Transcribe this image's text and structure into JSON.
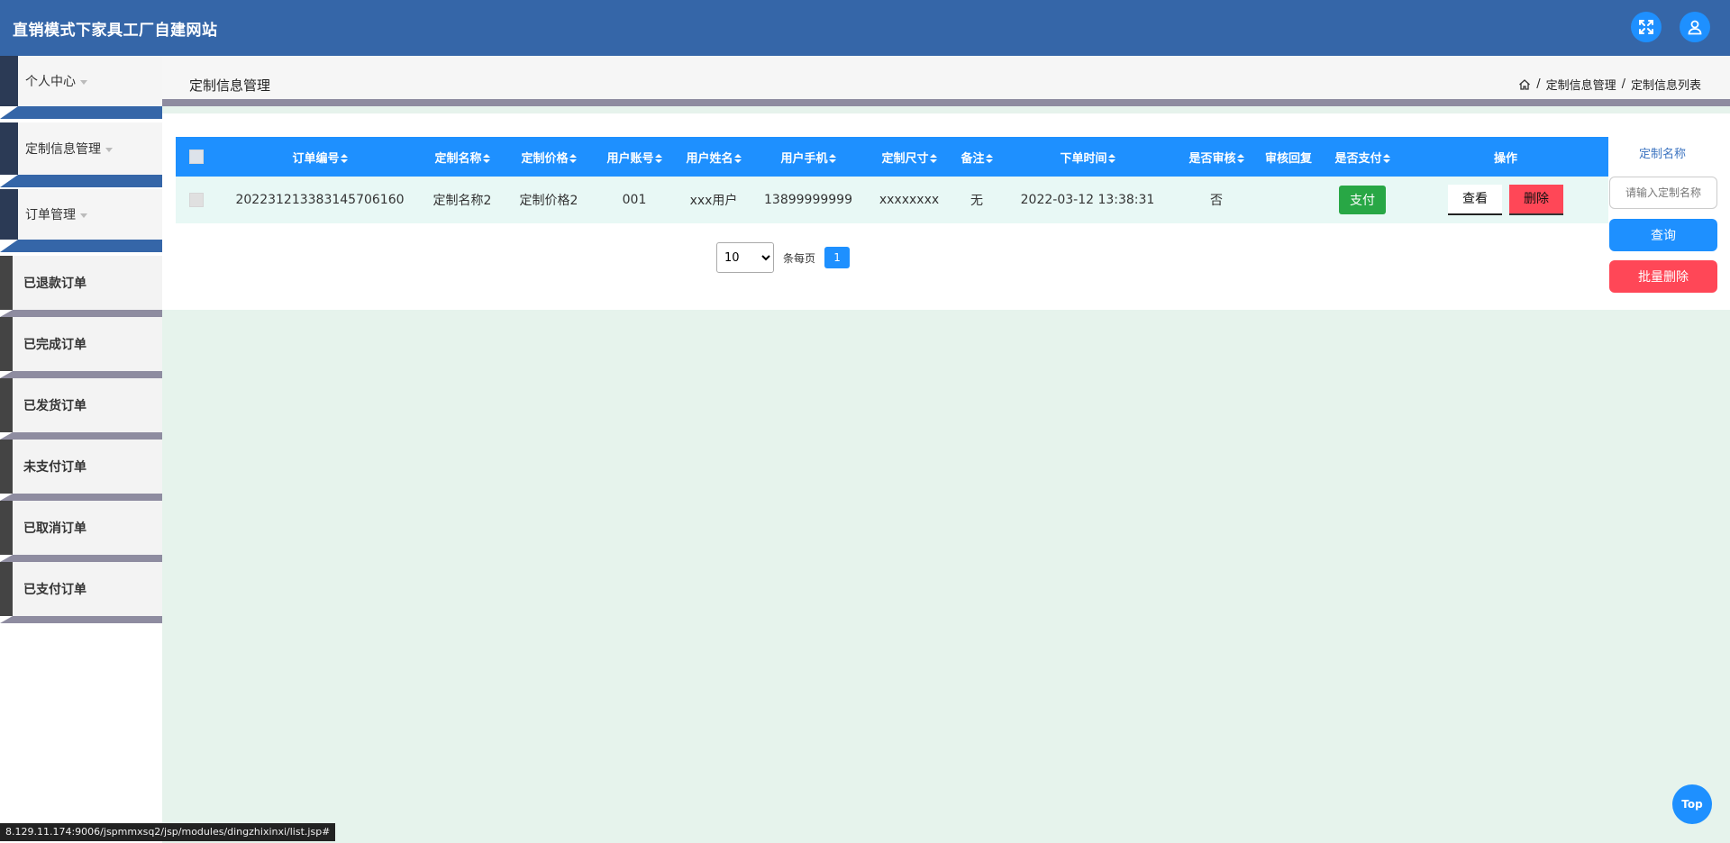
{
  "header": {
    "title": "直销模式下家具工厂自建网站"
  },
  "sidebar": {
    "menus": [
      {
        "label": "个人中心"
      },
      {
        "label": "定制信息管理"
      },
      {
        "label": "订单管理"
      }
    ],
    "sub_items": [
      {
        "label": "已退款订单"
      },
      {
        "label": "已完成订单"
      },
      {
        "label": "已发货订单"
      },
      {
        "label": "未支付订单"
      },
      {
        "label": "已取消订单"
      },
      {
        "label": "已支付订单"
      }
    ]
  },
  "page": {
    "title": "定制信息管理",
    "breadcrumb": [
      "定制信息管理",
      "定制信息列表"
    ],
    "breadcrumb_sep": "/"
  },
  "table": {
    "columns": [
      "订单编号",
      "定制名称",
      "定制价格",
      "用户账号",
      "用户姓名",
      "用户手机",
      "定制尺寸",
      "备注",
      "下单时间",
      "是否审核",
      "审核回复",
      "是否支付",
      "操作"
    ],
    "rows": [
      {
        "order_no": "202231213383145706160",
        "name": "定制名称2",
        "price": "定制价格2",
        "account": "001",
        "user_name": "xxx用户",
        "phone": "13899999999",
        "size": "xxxxxxxx",
        "remark": "无",
        "order_time": "2022-03-12 13:38:31",
        "reviewed": "否",
        "review_reply": "",
        "pay_label": "支付",
        "view_label": "查看",
        "delete_label": "删除"
      }
    ]
  },
  "pager": {
    "page_size": "10",
    "page_size_options": [
      "10"
    ],
    "per_page_label": "条每页",
    "current_page": "1"
  },
  "search": {
    "label": "定制名称",
    "placeholder": "请输入定制名称",
    "query_label": "查询",
    "batch_delete_label": "批量删除"
  },
  "status_url": "8.129.11.174:9006/jspmmxsq2/jsp/modules/dingzhixinxi/list.jsp#",
  "top_button": "Top",
  "colors": {
    "header": "#3566a8",
    "accent": "#1e90ff",
    "danger": "#ff4757",
    "success": "#28a745"
  }
}
